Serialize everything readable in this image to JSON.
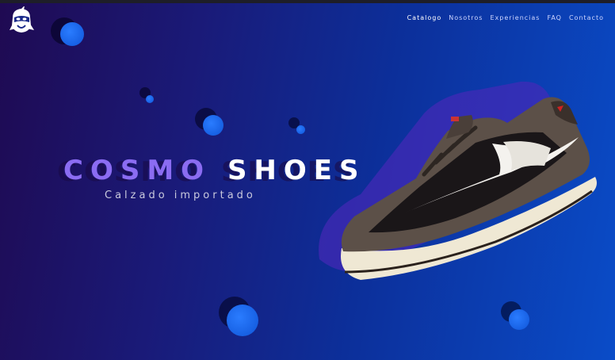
{
  "brand": {
    "logo_icon": "ninja-mascot-logo-icon"
  },
  "nav": {
    "items": [
      {
        "label": "Catalogo"
      },
      {
        "label": "Nosotros"
      },
      {
        "label": "Experiencias"
      },
      {
        "label": "FAQ"
      },
      {
        "label": "Contacto"
      }
    ]
  },
  "hero": {
    "title_word1": "COSMO",
    "title_word2": "SHOES",
    "subtitle": "Calzado importado",
    "product_image": "sneaker-image"
  },
  "colors": {
    "background_start": "#1f0a52",
    "background_end": "#0a4cc8",
    "accent_purple": "#8b6cf2",
    "bubble_blue": "#1a66f0"
  }
}
